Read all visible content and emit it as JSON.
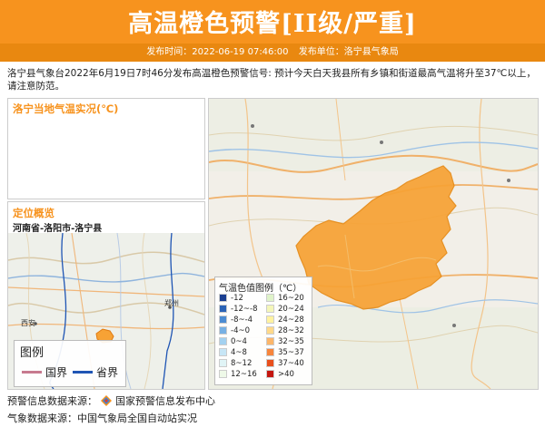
{
  "header": {
    "title": "高温橙色预警[II级/严重]",
    "publish_time_label": "发布时间：2022-06-19 07:46:00",
    "publisher_label": "发布单位：洛宁县气象局",
    "color": "#f7931e"
  },
  "description": "洛宁县气象台2022年6月19日7时46分发布高温橙色预警信号: 预计今天白天我县所有乡镇和街道最高气温将升至37℃以上，请注意防范。",
  "temp_panel": {
    "title": "洛宁当地气温实况(℃)"
  },
  "location_panel": {
    "title": "定位概览",
    "path": "河南省-洛阳市-洛宁县",
    "mini_legend": {
      "title": "图例",
      "items": [
        {
          "label": "国界",
          "color": "#c77a8f"
        },
        {
          "label": "省界",
          "color": "#1f55b4"
        }
      ]
    },
    "city_labels": [
      "西安",
      "郑州"
    ]
  },
  "map_legend": {
    "title": "气温色值图例（℃）",
    "items": [
      {
        "label": "-12",
        "color": "#1b3f91"
      },
      {
        "label": "-12~-8",
        "color": "#2b63b6"
      },
      {
        "label": "-8~-4",
        "color": "#4c8cd3"
      },
      {
        "label": "-4~0",
        "color": "#77b0e4"
      },
      {
        "label": "0~4",
        "color": "#a3d1f0"
      },
      {
        "label": "4~8",
        "color": "#c7e6f6"
      },
      {
        "label": "8~12",
        "color": "#e0f4f6"
      },
      {
        "label": "12~16",
        "color": "#eef9e8"
      },
      {
        "label": "16~20",
        "color": "#dff3c9"
      },
      {
        "label": "20~24",
        "color": "#f4f6b8"
      },
      {
        "label": "24~28",
        "color": "#fff2a0"
      },
      {
        "label": "28~32",
        "color": "#ffd98a"
      },
      {
        "label": "32~35",
        "color": "#fcb66a"
      },
      {
        "label": "35~37",
        "color": "#f7853c"
      },
      {
        "label": "37~40",
        "color": "#e84f1c"
      },
      {
        "label": ">40",
        "color": "#c4160e"
      }
    ]
  },
  "sources": {
    "warning_label": "预警信息数据来源：",
    "warning_value": "国家预警信息发布中心",
    "weather_label": "气象数据来源：",
    "weather_value": "中国气象局全国自动站实况"
  }
}
